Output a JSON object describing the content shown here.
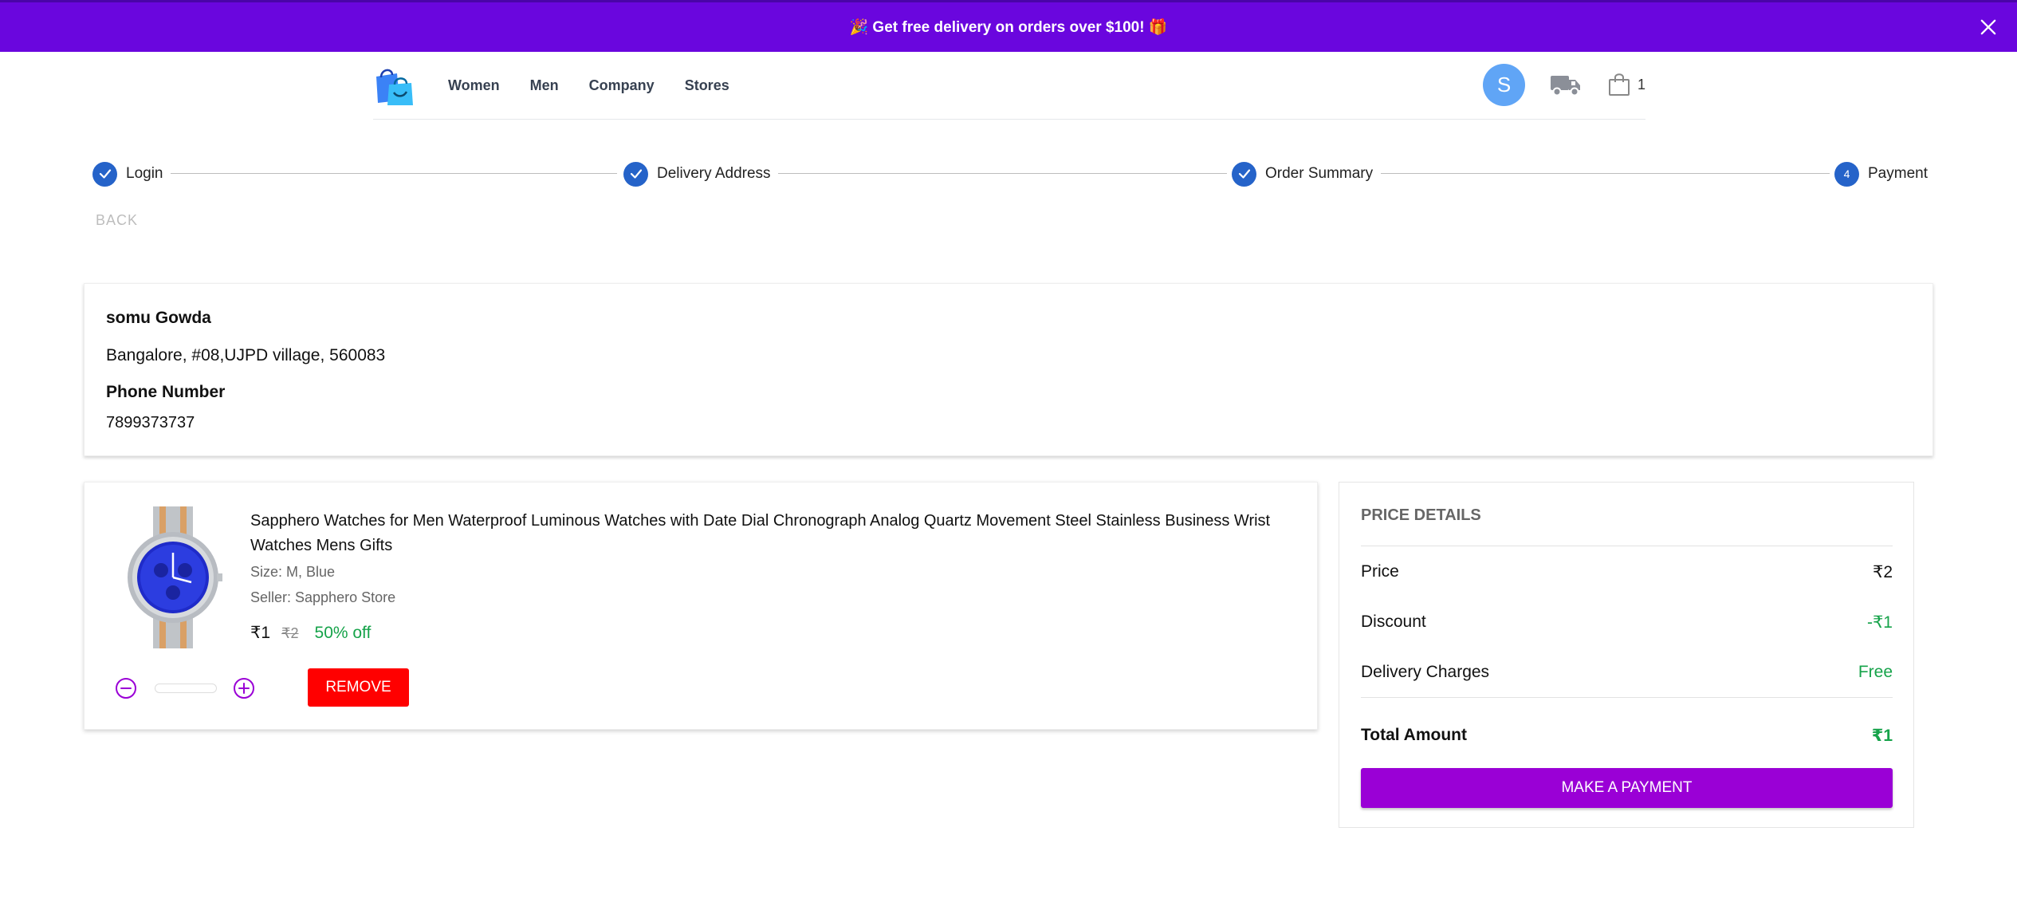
{
  "promo": {
    "text": "🎉 Get free delivery on orders over $100! 🎁",
    "icons": [
      "close-icon"
    ]
  },
  "header": {
    "logo_icon": "shopping-bags-logo",
    "nav": [
      "Women",
      "Men",
      "Company",
      "Stores"
    ],
    "avatar_initial": "S",
    "cart_count": "1",
    "icons": [
      "truck-icon",
      "shopping-bag-icon"
    ]
  },
  "stepper": {
    "steps": [
      {
        "label": "Login",
        "status": "done"
      },
      {
        "label": "Delivery Address",
        "status": "done"
      },
      {
        "label": "Order Summary",
        "status": "done"
      },
      {
        "label": "Payment",
        "status": "active",
        "number": "4"
      }
    ],
    "back_label": "BACK"
  },
  "address": {
    "name": "somu Gowda",
    "line": "Bangalore, #08,UJPD village, 560083",
    "phone_label": "Phone Number",
    "phone": "7899373737"
  },
  "product": {
    "title": "Sapphero Watches for Men Waterproof Luminous Watches with Date Dial Chronograph Analog Quartz Movement Steel Stainless Business Wrist Watches Mens Gifts",
    "size": "Size: M, Blue",
    "seller": "Seller: Sapphero Store",
    "price": "₹1",
    "original_price": "₹2",
    "discount": "50% off",
    "quantity": "",
    "remove_label": "REMOVE"
  },
  "price_details": {
    "title": "PRICE DETAILS",
    "price_label": "Price",
    "price_value": "₹2",
    "discount_label": "Discount",
    "discount_value": "-₹1",
    "delivery_label": "Delivery Charges",
    "delivery_value": "Free",
    "total_label": "Total Amount",
    "total_value": "₹1",
    "pay_label": "MAKE A PAYMENT"
  },
  "colors": {
    "banner": "#6a06de",
    "step": "#2563c9",
    "accent_purple": "#9a00d6",
    "remove_red": "#ff0000",
    "green": "#16a34a"
  }
}
